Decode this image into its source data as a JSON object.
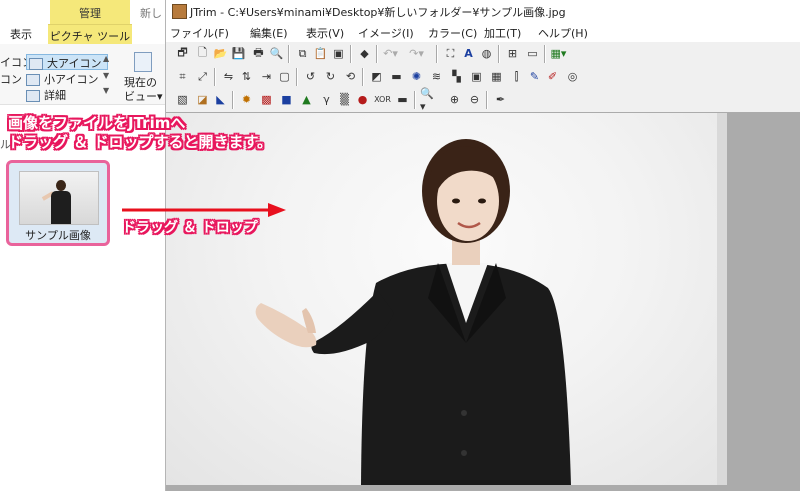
{
  "explorer": {
    "tabs": {
      "manage": "管理",
      "new_partial": "新し",
      "view": "表示",
      "picture_tools": "ピクチャ ツール"
    },
    "layout": {
      "left_partial_1": "イコン",
      "left_partial_2": "コン",
      "large_icons": "大アイコン",
      "small_icons": "小アイコン",
      "details": "詳細"
    },
    "current_view": {
      "line1": "現在の",
      "line2": "ビュー▾"
    },
    "left_partial_label": "ル",
    "file": {
      "name": "サンプル画像"
    }
  },
  "annotations": {
    "instruction_line1": "画像をファイルをJTrimへ",
    "instruction_line2": "ドラッグ ＆ ドロップすると開きます。",
    "drag_label": "ドラッグ ＆ ドロップ",
    "accent_color": "#e8175d",
    "arrow_color": "#e8101e"
  },
  "jtrim": {
    "title": "JTrim - C:¥Users¥minami¥Desktop¥新しいフォルダー¥サンプル画像.jpg",
    "menu": [
      "ファイル(F)",
      "編集(E)",
      "表示(V)",
      "イメージ(I)",
      "カラー(C)",
      "加工(T)",
      "ヘルプ(H)"
    ]
  }
}
